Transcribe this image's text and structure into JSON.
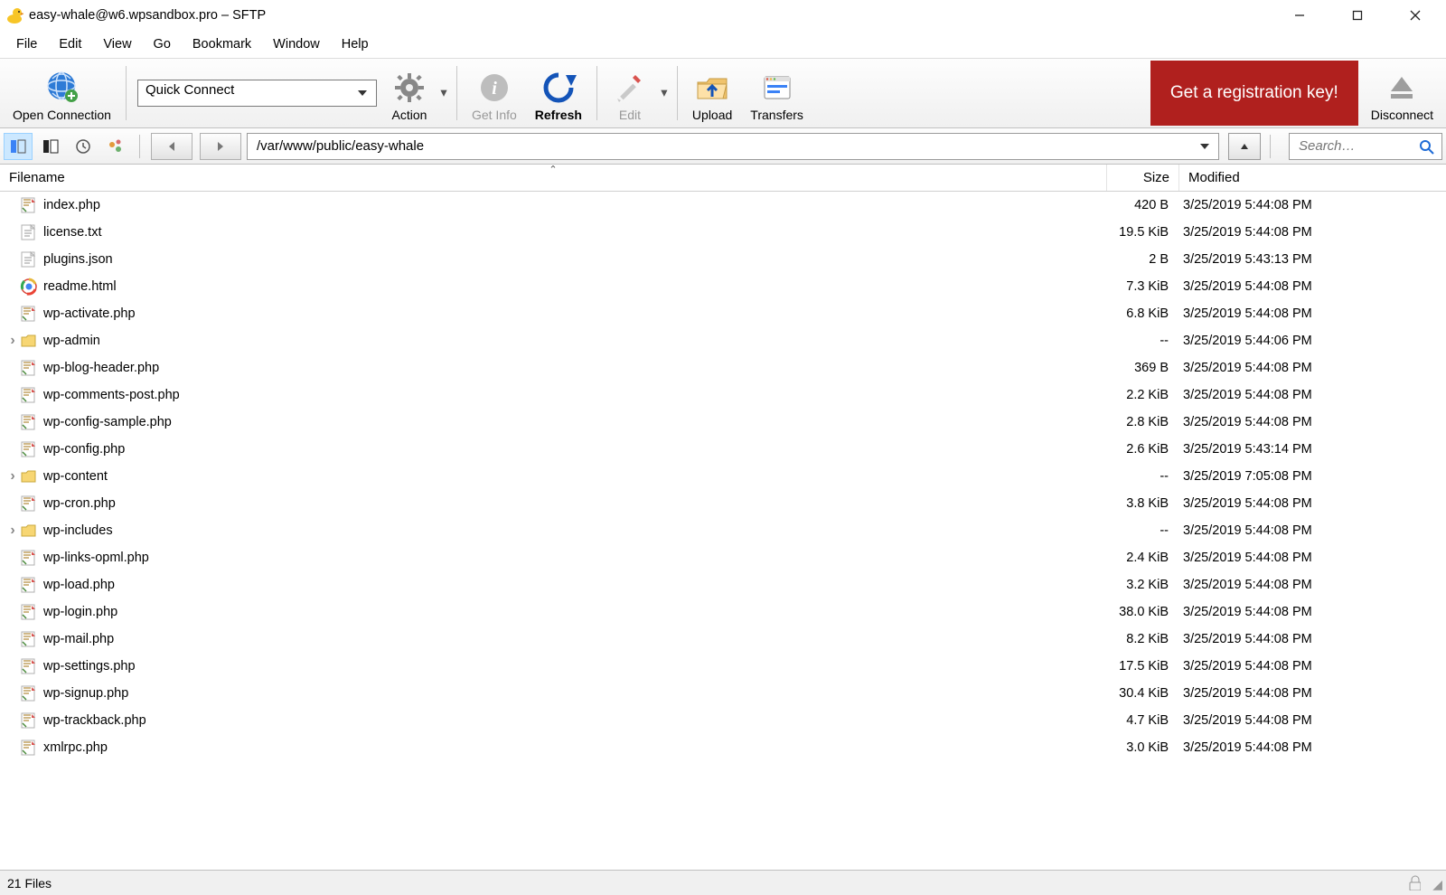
{
  "title": "easy-whale@w6.wpsandbox.pro – SFTP",
  "menu": [
    "File",
    "Edit",
    "View",
    "Go",
    "Bookmark",
    "Window",
    "Help"
  ],
  "toolbar": {
    "open_connection": "Open Connection",
    "quick_connect": "Quick Connect",
    "action": "Action",
    "get_info": "Get Info",
    "refresh": "Refresh",
    "edit": "Edit",
    "upload": "Upload",
    "transfers": "Transfers",
    "registration": "Get a registration key!",
    "disconnect": "Disconnect"
  },
  "nav": {
    "path": "/var/www/public/easy-whale",
    "search_placeholder": "Search…"
  },
  "columns": {
    "filename": "Filename",
    "size": "Size",
    "modified": "Modified"
  },
  "files": [
    {
      "name": "index.php",
      "type": "php",
      "size": "420 B",
      "modified": "3/25/2019 5:44:08 PM"
    },
    {
      "name": "license.txt",
      "type": "txt",
      "size": "19.5 KiB",
      "modified": "3/25/2019 5:44:08 PM"
    },
    {
      "name": "plugins.json",
      "type": "txt",
      "size": "2 B",
      "modified": "3/25/2019 5:43:13 PM"
    },
    {
      "name": "readme.html",
      "type": "html",
      "size": "7.3 KiB",
      "modified": "3/25/2019 5:44:08 PM"
    },
    {
      "name": "wp-activate.php",
      "type": "php",
      "size": "6.8 KiB",
      "modified": "3/25/2019 5:44:08 PM"
    },
    {
      "name": "wp-admin",
      "type": "folder",
      "size": "--",
      "modified": "3/25/2019 5:44:06 PM",
      "expandable": true
    },
    {
      "name": "wp-blog-header.php",
      "type": "php",
      "size": "369 B",
      "modified": "3/25/2019 5:44:08 PM"
    },
    {
      "name": "wp-comments-post.php",
      "type": "php",
      "size": "2.2 KiB",
      "modified": "3/25/2019 5:44:08 PM"
    },
    {
      "name": "wp-config-sample.php",
      "type": "php",
      "size": "2.8 KiB",
      "modified": "3/25/2019 5:44:08 PM"
    },
    {
      "name": "wp-config.php",
      "type": "php",
      "size": "2.6 KiB",
      "modified": "3/25/2019 5:43:14 PM"
    },
    {
      "name": "wp-content",
      "type": "folder",
      "size": "--",
      "modified": "3/25/2019 7:05:08 PM",
      "expandable": true
    },
    {
      "name": "wp-cron.php",
      "type": "php",
      "size": "3.8 KiB",
      "modified": "3/25/2019 5:44:08 PM"
    },
    {
      "name": "wp-includes",
      "type": "folder",
      "size": "--",
      "modified": "3/25/2019 5:44:08 PM",
      "expandable": true
    },
    {
      "name": "wp-links-opml.php",
      "type": "php",
      "size": "2.4 KiB",
      "modified": "3/25/2019 5:44:08 PM"
    },
    {
      "name": "wp-load.php",
      "type": "php",
      "size": "3.2 KiB",
      "modified": "3/25/2019 5:44:08 PM"
    },
    {
      "name": "wp-login.php",
      "type": "php",
      "size": "38.0 KiB",
      "modified": "3/25/2019 5:44:08 PM"
    },
    {
      "name": "wp-mail.php",
      "type": "php",
      "size": "8.2 KiB",
      "modified": "3/25/2019 5:44:08 PM"
    },
    {
      "name": "wp-settings.php",
      "type": "php",
      "size": "17.5 KiB",
      "modified": "3/25/2019 5:44:08 PM"
    },
    {
      "name": "wp-signup.php",
      "type": "php",
      "size": "30.4 KiB",
      "modified": "3/25/2019 5:44:08 PM"
    },
    {
      "name": "wp-trackback.php",
      "type": "php",
      "size": "4.7 KiB",
      "modified": "3/25/2019 5:44:08 PM"
    },
    {
      "name": "xmlrpc.php",
      "type": "php",
      "size": "3.0 KiB",
      "modified": "3/25/2019 5:44:08 PM"
    }
  ],
  "status": "21 Files"
}
